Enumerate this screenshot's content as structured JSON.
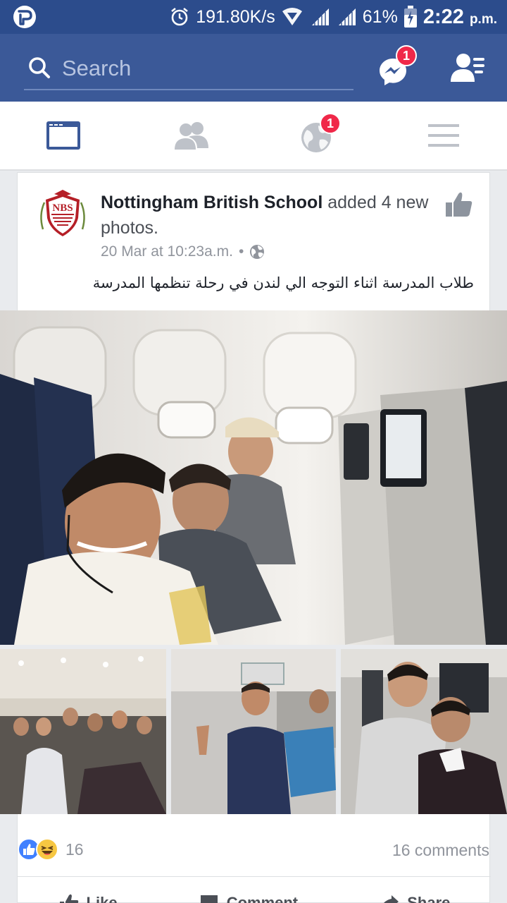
{
  "status_bar": {
    "speed": "191.80K/s",
    "battery": "61%",
    "time": "2:22",
    "time_suffix": "p.m."
  },
  "search": {
    "placeholder": "Search"
  },
  "badges": {
    "messenger": "1",
    "notifications": "1"
  },
  "tabs": [
    "news-feed",
    "friends",
    "notifications",
    "menu"
  ],
  "post": {
    "page_name": "Nottingham British School",
    "action_text": " added 4 new photos.",
    "timestamp": "20 Mar at 10:23a.m.",
    "separator": "•",
    "privacy": "public",
    "caption": "طلاب المدرسة اثناء التوجه الي لندن في رحلة تنظمها المدرسة",
    "logo_text": "NBS",
    "reaction_count": "16",
    "comments": "16 comments",
    "actions": {
      "like": "Like",
      "comment": "Comment",
      "share": "Share"
    }
  },
  "colors": {
    "fb_blue": "#3b5998",
    "status_bar": "#2c4c8c",
    "badge": "#f02849",
    "like_blue": "#4080ff",
    "haha_yellow": "#f7c742"
  }
}
